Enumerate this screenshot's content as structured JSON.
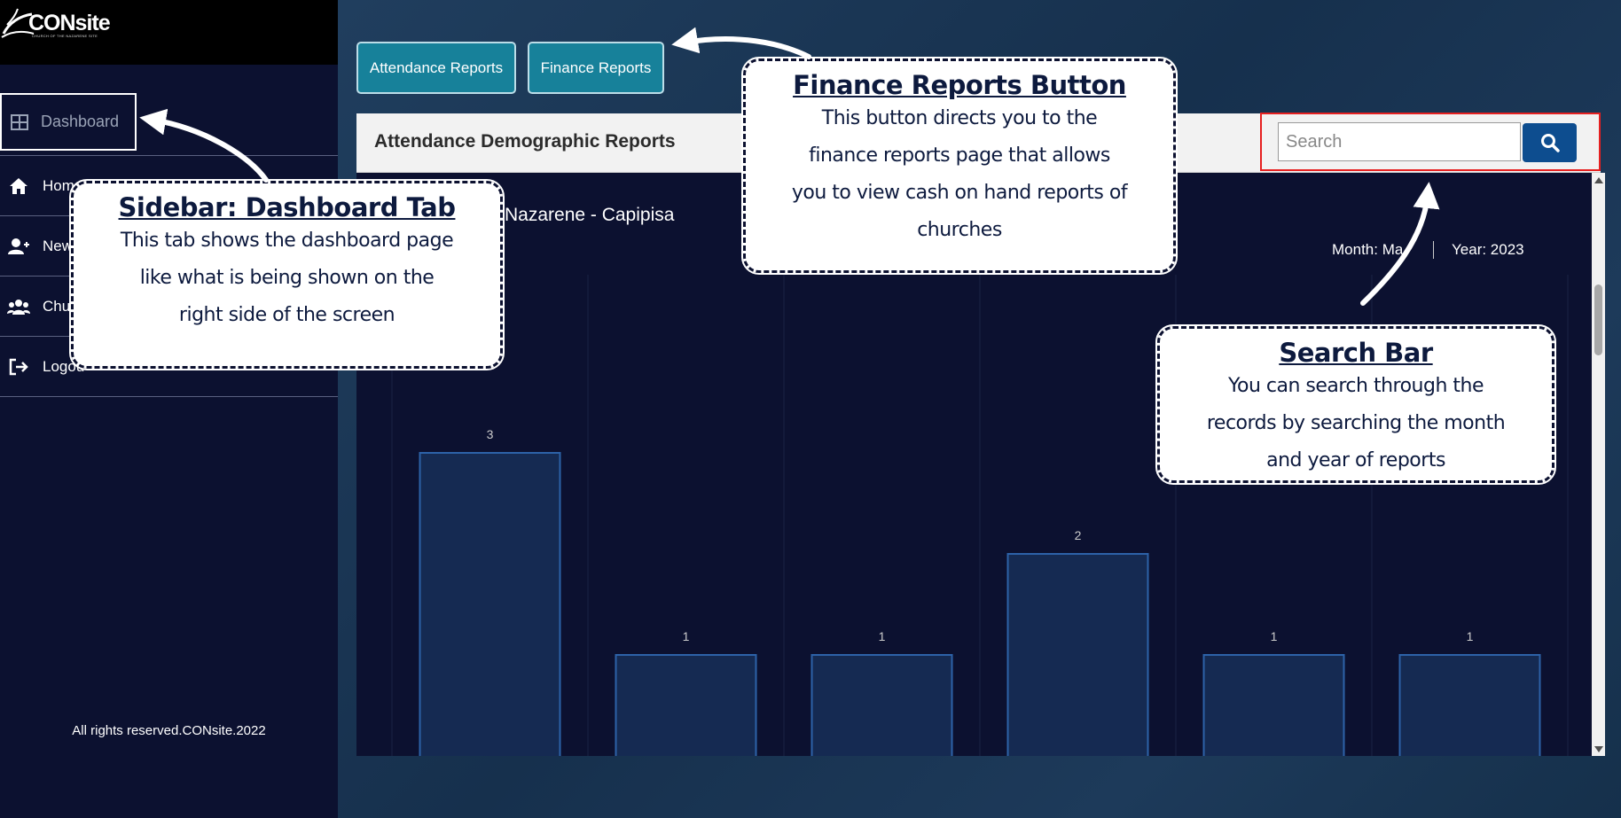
{
  "app": {
    "logo_text": "CONsite",
    "logo_tagline": "CHURCH OF THE NAZARENE SITE"
  },
  "sidebar": {
    "items": [
      {
        "label": "Dashboard",
        "icon": "table-grid-icon"
      },
      {
        "label": "Home",
        "icon": "home-icon"
      },
      {
        "label": "New",
        "icon": "add-user-icon"
      },
      {
        "label": "Chur",
        "icon": "users-group-icon"
      },
      {
        "label": "Logou",
        "icon": "logout-icon"
      }
    ],
    "footer": "All rights reserved.CONsite.2022"
  },
  "tabs": {
    "attendance": "Attendance Reports",
    "finance": "Finance Reports"
  },
  "card": {
    "title": "Attendance Demographic Reports"
  },
  "search": {
    "placeholder": "Search",
    "button_icon": "search-icon"
  },
  "report": {
    "church": "Nazarene - Capipisa",
    "month": "Month: Ma",
    "year": "Year: 2023"
  },
  "chart_data": {
    "type": "bar",
    "values": [
      3,
      1,
      1,
      2,
      1,
      1
    ],
    "ylim": [
      0,
      4.5
    ]
  },
  "callouts": {
    "sidebar": {
      "title": "Sidebar: Dashboard Tab",
      "lines": [
        "This tab shows the dashboard page",
        "like what is being shown on the",
        "right side of the screen"
      ]
    },
    "finance": {
      "title": "Finance Reports Button",
      "lines": [
        "This button directs you to the",
        "finance reports page that allows",
        "you to view cash on hand reports of",
        "churches"
      ]
    },
    "search": {
      "title": "Search Bar",
      "lines": [
        "You can search through the",
        "records by searching the month",
        "and year of reports"
      ]
    }
  },
  "colors": {
    "sidebar_bg": "#0c1130",
    "tab_button": "#17819a",
    "search_button": "#0d4d8f",
    "highlight_border": "#e62020",
    "bar_fill": "#152a52",
    "bar_border": "#2d62a8"
  }
}
